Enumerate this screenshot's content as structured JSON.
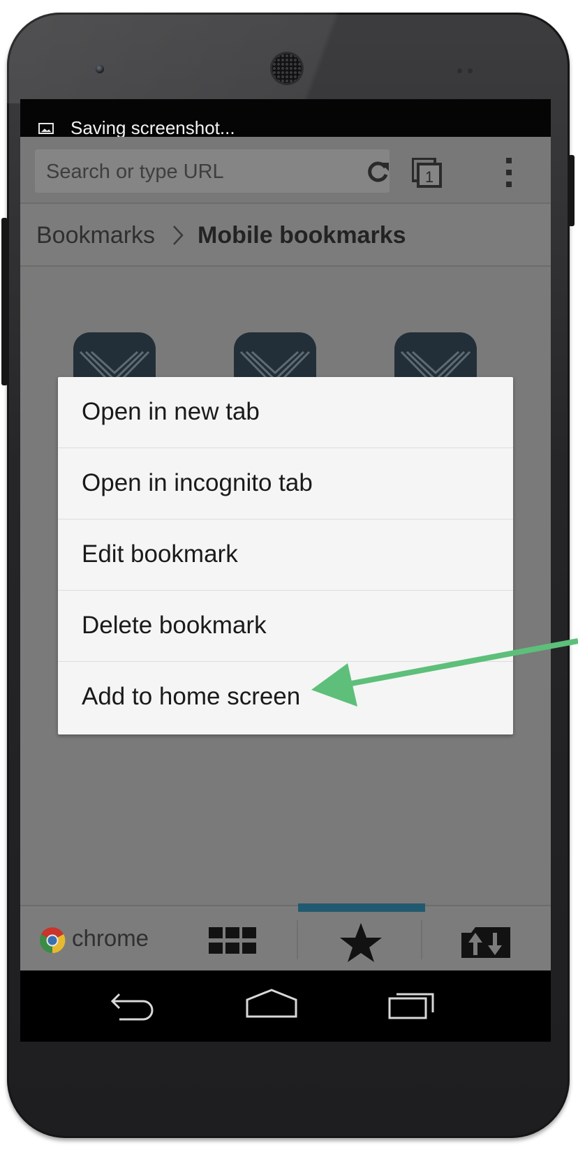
{
  "status_bar": {
    "notification_text": "Saving screenshot..."
  },
  "toolbar": {
    "omnibox_placeholder": "Search or type URL",
    "tab_count": "1"
  },
  "breadcrumb": {
    "root": "Bookmarks",
    "current": "Mobile bookmarks"
  },
  "context_menu": {
    "items": [
      "Open in new tab",
      "Open in incognito tab",
      "Edit bookmark",
      "Delete bookmark",
      "Add to home screen"
    ]
  },
  "bottom_bar": {
    "brand": "chrome",
    "active_tab": "bookmarks"
  },
  "colors": {
    "annotation_arrow": "#5dbf7a",
    "active_indicator": "#215a70",
    "bookmark_tile": "#232f38"
  }
}
